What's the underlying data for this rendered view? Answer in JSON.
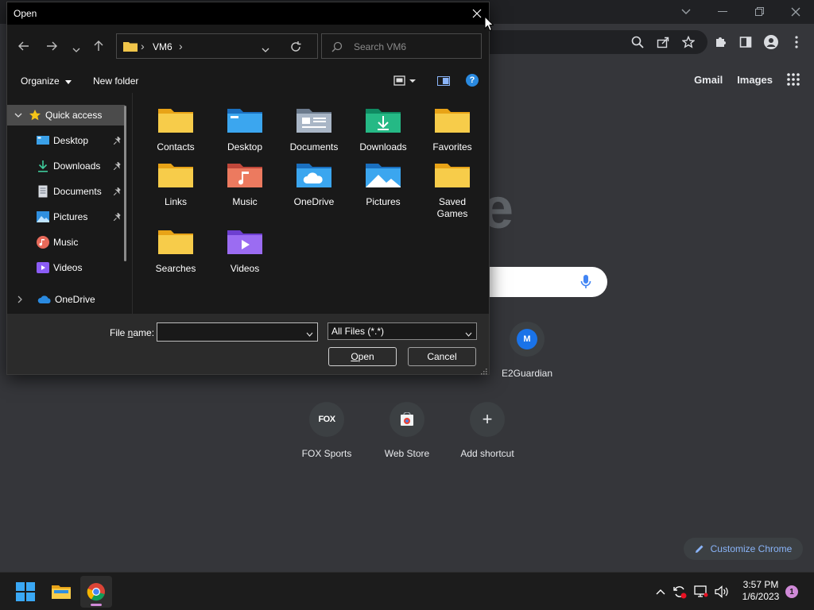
{
  "chrome": {
    "links": {
      "gmail": "Gmail",
      "images": "Images"
    },
    "shortcuts": [
      {
        "label": "E2Guardian",
        "initial": "M"
      },
      {
        "label": "FOX Sports",
        "logo_text": "FOX"
      },
      {
        "label": "Web Store"
      },
      {
        "label": "Add shortcut",
        "symbol": "+"
      }
    ],
    "customize_label": "Customize Chrome",
    "accent": "#8ab4f8"
  },
  "dialog": {
    "title": "Open",
    "address": {
      "folder": "VM6",
      "sep1": "›",
      "sep2": "›"
    },
    "search_placeholder": "Search VM6",
    "organize_label": "Organize",
    "new_folder_label": "New folder",
    "nav_items": [
      {
        "label": "Quick access",
        "icon": "star-icon",
        "selected": true,
        "expanded": true
      },
      {
        "label": "Desktop",
        "icon": "desktop-icon",
        "pinned": true
      },
      {
        "label": "Downloads",
        "icon": "download-icon",
        "pinned": true
      },
      {
        "label": "Documents",
        "icon": "document-icon",
        "pinned": true
      },
      {
        "label": "Pictures",
        "icon": "pictures-icon",
        "pinned": true
      },
      {
        "label": "Music",
        "icon": "music-icon"
      },
      {
        "label": "Videos",
        "icon": "videos-icon"
      },
      {
        "label": "OneDrive",
        "icon": "onedrive-icon"
      }
    ],
    "files": [
      {
        "label": "Contacts",
        "icon": "folder-icon"
      },
      {
        "label": "Desktop",
        "icon": "desktop-folder-icon"
      },
      {
        "label": "Documents",
        "icon": "documents-folder-icon"
      },
      {
        "label": "Downloads",
        "icon": "downloads-folder-icon"
      },
      {
        "label": "Favorites",
        "icon": "folder-icon"
      },
      {
        "label": "Links",
        "icon": "folder-icon"
      },
      {
        "label": "Music",
        "icon": "music-folder-icon"
      },
      {
        "label": "OneDrive",
        "icon": "onedrive-folder-icon"
      },
      {
        "label": "Pictures",
        "icon": "pictures-folder-icon"
      },
      {
        "label": "Saved Games",
        "icon": "folder-icon"
      },
      {
        "label": "Searches",
        "icon": "folder-icon"
      },
      {
        "label": "Videos",
        "icon": "videos-folder-icon"
      }
    ],
    "filename_label_pre": "File ",
    "filename_label_accel": "n",
    "filename_label_post": "ame:",
    "filename_value": "",
    "filetype_value": "All Files (*.*)",
    "open_label_accel": "O",
    "open_label_rest": "pen",
    "cancel_label": "Cancel"
  },
  "taskbar": {
    "time": "3:57 PM",
    "date": "1/6/2023",
    "notification_count": "1"
  }
}
